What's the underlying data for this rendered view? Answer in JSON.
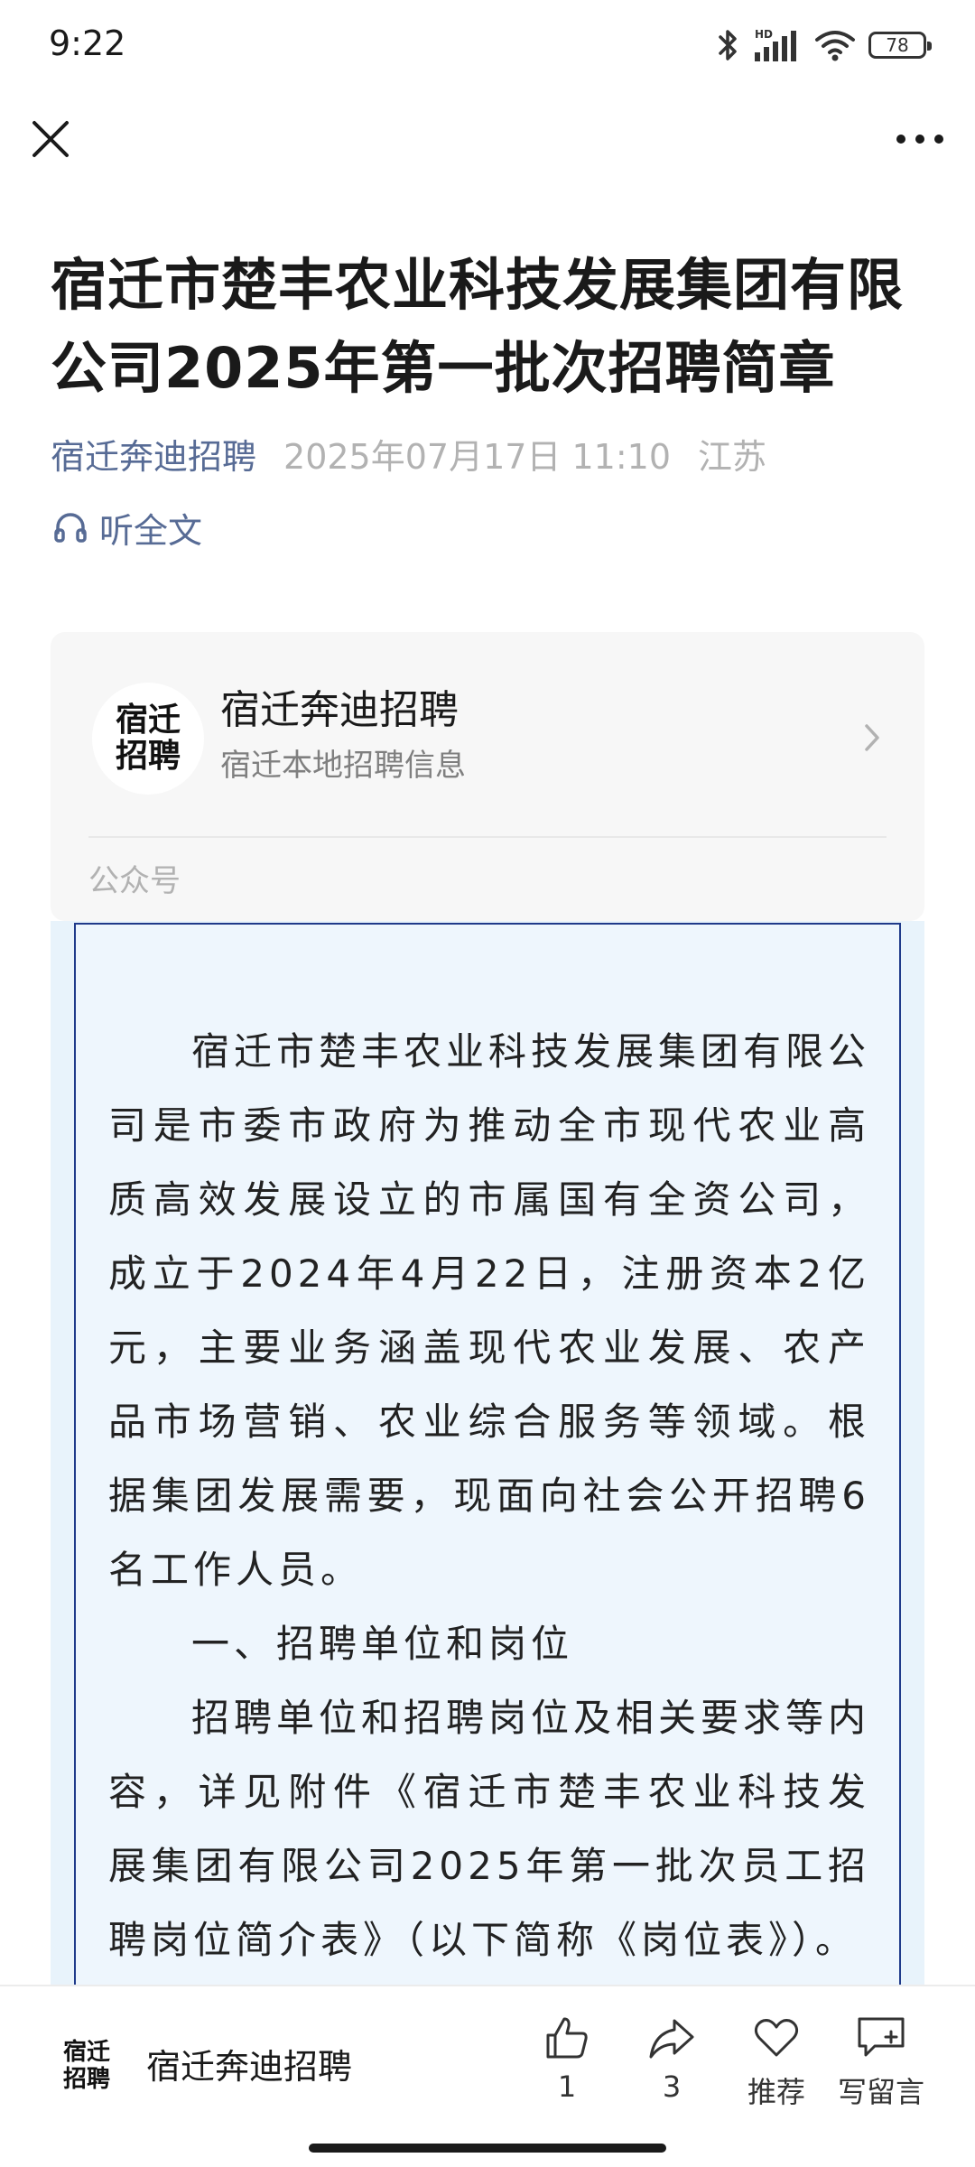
{
  "status_bar": {
    "time": "9:22",
    "battery_level": "78",
    "icons": [
      "bluetooth-icon",
      "hd-signal-icon",
      "wifi-icon",
      "battery-icon"
    ]
  },
  "nav": {
    "close_icon": "close-icon",
    "more_icon": "more-icon"
  },
  "article": {
    "title": "宿迁市楚丰农业科技发展集团有限公司2025年第一批次招聘简章",
    "author": "宿迁奔迪招聘",
    "date": "2025年07月17日 11:10",
    "location": "江苏",
    "listen_label": "听全文",
    "paragraphs": [
      "宿迁市楚丰农业科技发展集团有限公司是市委市政府为推动全市现代农业高质高效发展设立的市属国有全资公司，成立于2024年4月22日，注册资本2亿元，主要业务涵盖现代农业发展、农产品市场营销、农业综合服务等领域。根据集团发展需要，现面向社会公开招聘6名工作人员。",
      "一、招聘单位和岗位",
      "招聘单位和招聘岗位及相关要求等内容，详见附件《宿迁市楚丰农业科技发展集团有限公司2025年第一批次员工招聘岗位简介表》（以下简称《岗位表》）。"
    ]
  },
  "account_card": {
    "avatar_line1": "宿迁",
    "avatar_line2": "招聘",
    "name": "宿迁奔迪招聘",
    "description": "宿迁本地招聘信息",
    "type_label": "公众号"
  },
  "bottom_bar": {
    "avatar_line1": "宿迁",
    "avatar_line2": "招聘",
    "account_name": "宿迁奔迪招聘",
    "like_count": "1",
    "share_count": "3",
    "recommend_label": "推荐",
    "comment_label": "写留言"
  },
  "colors": {
    "link_blue": "#576b95",
    "body_background": "#eef6fd",
    "body_border": "#1f3a8a",
    "avatar_accent": "#e8a400"
  }
}
